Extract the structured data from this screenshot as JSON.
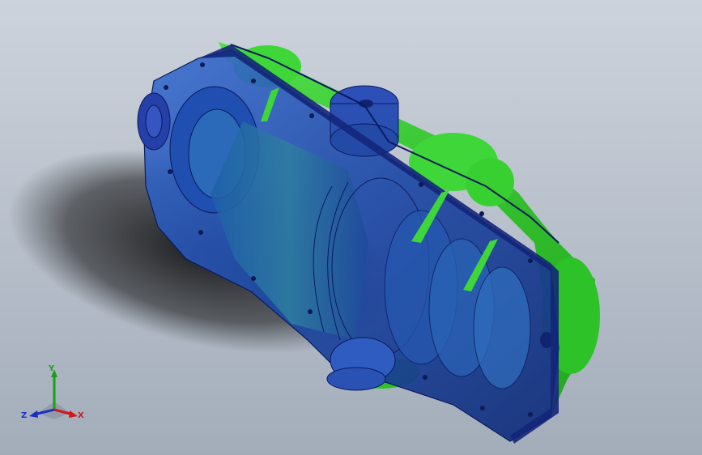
{
  "viewport": {
    "background_top": "#cdd3dc",
    "background_bottom": "#a3adba"
  },
  "model": {
    "body_color": "#1f3fa8",
    "section_color": "#2ec830",
    "edge_color": "#0a1a5c"
  },
  "triad": {
    "x_label": "X",
    "y_label": "Y",
    "z_label": "Z",
    "x_color": "#d01818",
    "y_color": "#18a018",
    "z_color": "#1830c8"
  }
}
